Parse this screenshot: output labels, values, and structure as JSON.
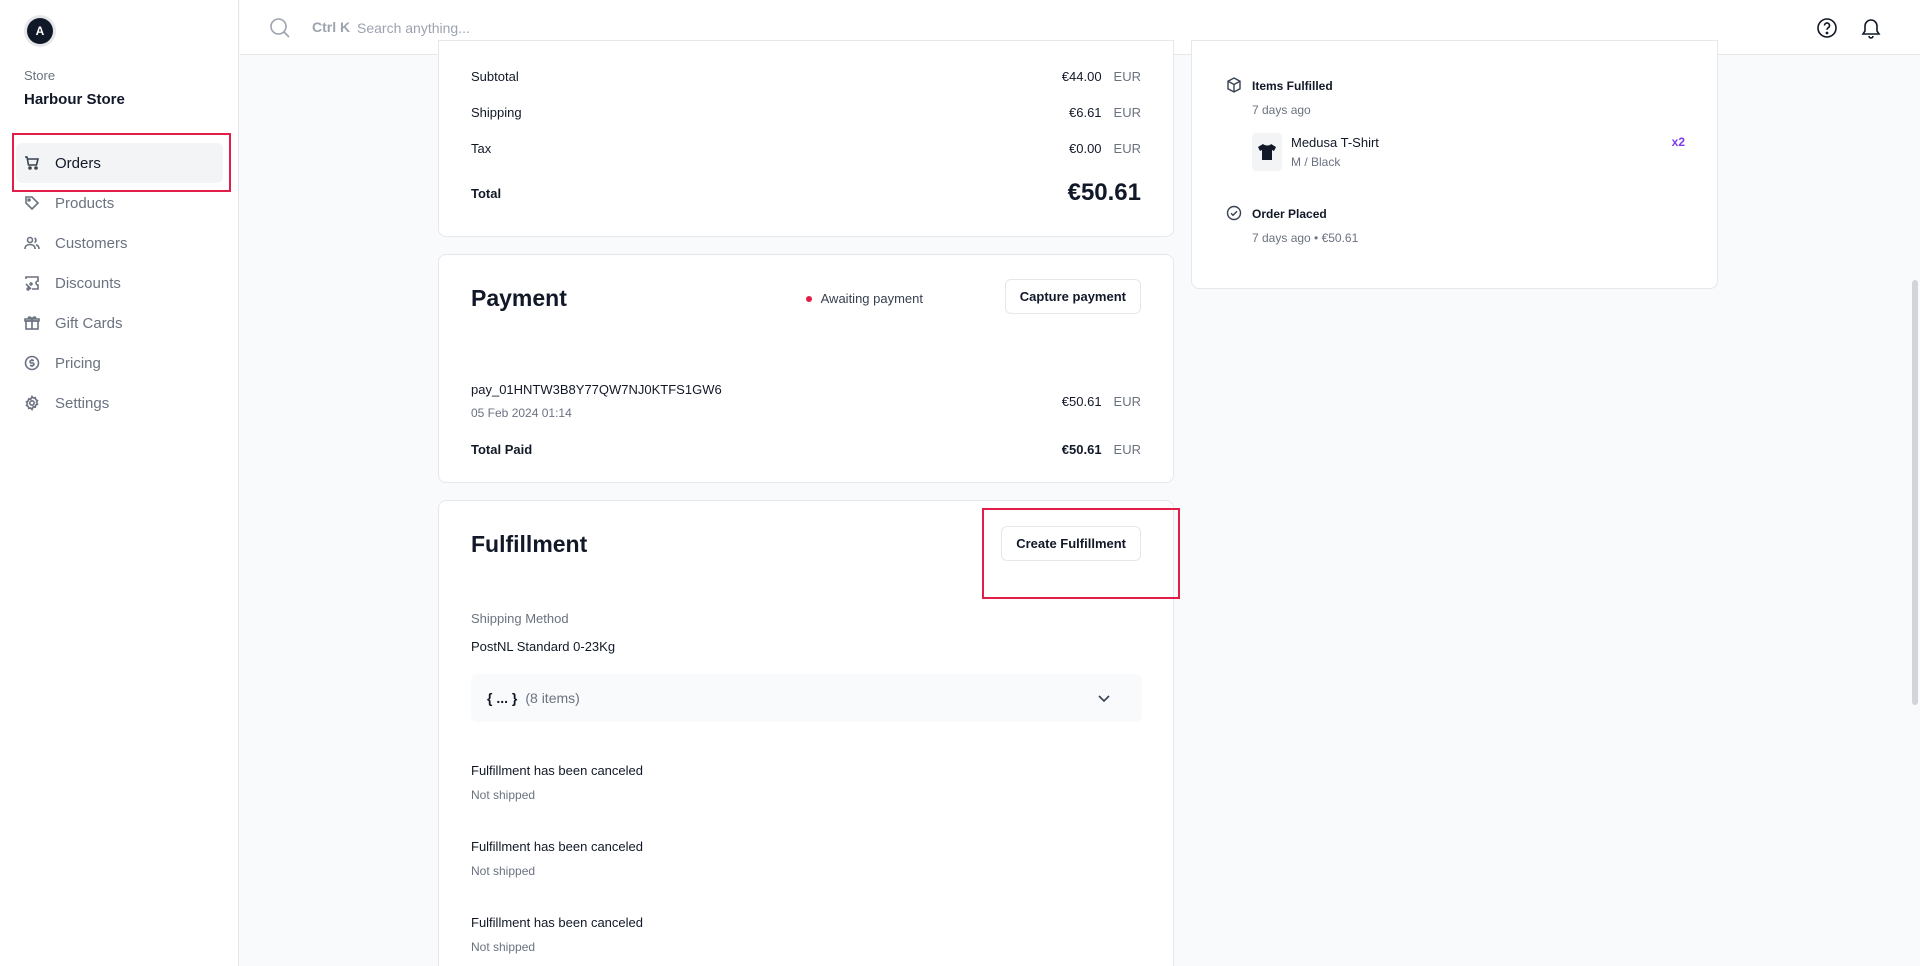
{
  "sidebar": {
    "avatar_initial": "A",
    "store_label": "Store",
    "store_name": "Harbour Store",
    "items": [
      {
        "label": "Orders",
        "icon": "cart-icon",
        "active": true
      },
      {
        "label": "Products",
        "icon": "tag-icon"
      },
      {
        "label": "Customers",
        "icon": "users-icon"
      },
      {
        "label": "Discounts",
        "icon": "discount-icon"
      },
      {
        "label": "Gift Cards",
        "icon": "gift-icon"
      },
      {
        "label": "Pricing",
        "icon": "pricing-icon"
      },
      {
        "label": "Settings",
        "icon": "gear-icon"
      }
    ]
  },
  "topbar": {
    "shortcut": "Ctrl K",
    "search_placeholder": "Search anything..."
  },
  "summary": {
    "subtotal_label": "Subtotal",
    "subtotal_value": "€44.00",
    "shipping_label": "Shipping",
    "shipping_value": "€6.61",
    "tax_label": "Tax",
    "tax_value": "€0.00",
    "total_label": "Total",
    "total_value": "€50.61",
    "currency": "EUR"
  },
  "payment": {
    "title": "Payment",
    "status": "Awaiting payment",
    "capture_label": "Capture payment",
    "payment_id": "pay_01HNTW3B8Y77QW7NJ0KTFS1GW6",
    "payment_date": "05 Feb 2024 01:14",
    "payment_amount": "€50.61",
    "total_paid_label": "Total Paid",
    "total_paid_value": "€50.61",
    "currency": "EUR"
  },
  "fulfillment": {
    "title": "Fulfillment",
    "create_label": "Create Fulfillment",
    "shipping_method_label": "Shipping Method",
    "shipping_method_value": "PostNL Standard 0-23Kg",
    "json_braces": "{ ... }",
    "json_count": "(8 items)",
    "entries": [
      {
        "title": "Fulfillment has been canceled",
        "status": "Not shipped"
      },
      {
        "title": "Fulfillment has been canceled",
        "status": "Not shipped"
      },
      {
        "title": "Fulfillment has been canceled",
        "status": "Not shipped"
      }
    ]
  },
  "timeline": {
    "items_fulfilled_title": "Items Fulfilled",
    "items_fulfilled_time": "7 days ago",
    "product_name": "Medusa T-Shirt",
    "product_variant": "M / Black",
    "product_qty": "x2",
    "order_placed_title": "Order Placed",
    "order_placed_sub": "7 days ago • €50.61"
  },
  "colors": {
    "accent_red": "#e11d48",
    "qty_purple": "#7c3aed"
  }
}
